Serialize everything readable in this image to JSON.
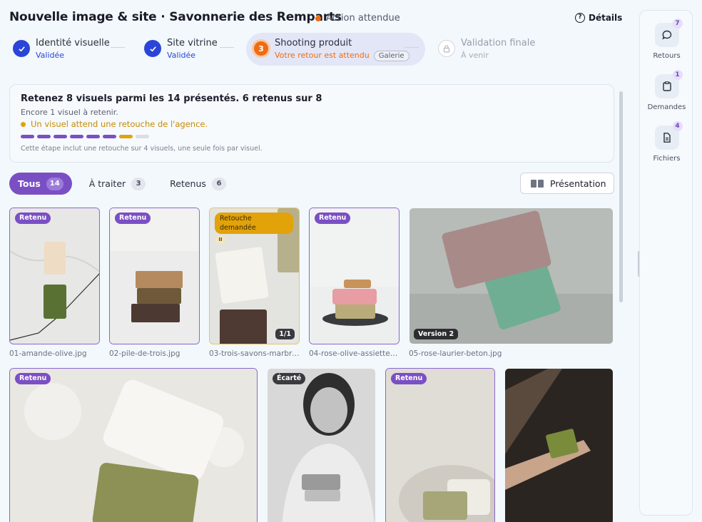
{
  "header": {
    "title": "Nouvelle image & site · Savonnerie des Remparts",
    "status": "Action attendue",
    "details_label": "Détails"
  },
  "steps": [
    {
      "label": "Identité visuelle",
      "sub": "Validée",
      "state": "done"
    },
    {
      "label": "Site vitrine",
      "sub": "Validée",
      "state": "done"
    },
    {
      "label": "Shooting produit",
      "sub": "Votre retour est attendu",
      "number": "3",
      "tag": "Galerie",
      "state": "current"
    },
    {
      "label": "Validation finale",
      "sub": "À venir",
      "state": "pending"
    }
  ],
  "info": {
    "headline": "Retenez 8 visuels parmi les 14 présentés. 6 retenus sur 8",
    "remaining": "Encore 1 visuel à retenir.",
    "alert": "Un visuel attend une retouche de l'agence.",
    "progress": {
      "retained": 6,
      "pending_retouch": 1,
      "total": 8
    },
    "note": "Cette étape inclut une retouche sur 4 visuels, une seule fois par visuel."
  },
  "filters": [
    {
      "label": "Tous",
      "count": "14",
      "active": true
    },
    {
      "label": "À traiter",
      "count": "3",
      "active": false
    },
    {
      "label": "Retenus",
      "count": "6",
      "active": false
    }
  ],
  "presentation_label": "Présentation",
  "photos": [
    {
      "file": "01-amande-olive.jpg",
      "badge": "Retenu"
    },
    {
      "file": "02-pile-de-trois.jpg",
      "badge": "Retenu"
    },
    {
      "file": "03-trois-savons-marbre.jpg",
      "badge": "Retouche demandée",
      "pause": "II",
      "counter": "1/1"
    },
    {
      "file": "04-rose-olive-assiette.jpg",
      "badge": "Retenu"
    },
    {
      "file": "05-rose-laurier-beton.jpg",
      "version": "Version 2"
    },
    {
      "file": "",
      "badge": "Retenu"
    },
    {
      "file": "",
      "badge": "Écarté"
    },
    {
      "file": "",
      "badge": "Retenu"
    },
    {
      "file": ""
    }
  ],
  "rail": [
    {
      "label": "Retours",
      "count": "7",
      "icon": "chat-icon"
    },
    {
      "label": "Demandes",
      "count": "1",
      "icon": "clipboard-icon"
    },
    {
      "label": "Fichiers",
      "count": "4",
      "icon": "document-icon"
    }
  ],
  "colors": {
    "accent": "#7b4fc4",
    "warning": "#e2a20a",
    "status": "#ef6c12",
    "done": "#2b45d8"
  }
}
